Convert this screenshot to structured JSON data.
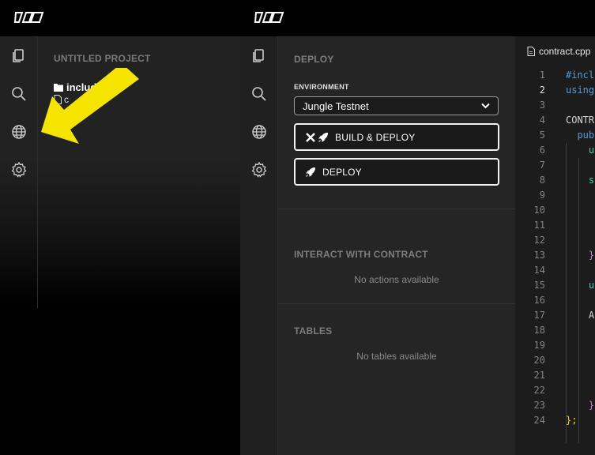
{
  "left": {
    "project_title": "UNTITLED PROJECT",
    "folder_label": "includ",
    "file_label": "c"
  },
  "deploy": {
    "title": "DEPLOY",
    "environment_label": "ENVIRONMENT",
    "environment_value": "Jungle Testnet",
    "build_deploy_label": "BUILD & DEPLOY",
    "deploy_label": "DEPLOY"
  },
  "interact": {
    "title": "INTERACT WITH CONTRACT",
    "empty": "No actions available"
  },
  "tables": {
    "title": "TABLES",
    "empty": "No tables available"
  },
  "editor": {
    "tab": "contract.cpp",
    "line_numbers": [
      "1",
      "2",
      "3",
      "4",
      "5",
      "6",
      "7",
      "8",
      "9",
      "10",
      "11",
      "12",
      "13",
      "14",
      "15",
      "16",
      "17",
      "18",
      "19",
      "20",
      "21",
      "22",
      "23",
      "24"
    ],
    "active_line": "2",
    "lines": [
      "#incl",
      "using",
      "",
      "CONTR",
      "  pub",
      "    u",
      "",
      "    s",
      "",
      "",
      "",
      "",
      "    }",
      "",
      "    u",
      "",
      "    A",
      "",
      "",
      "",
      "",
      "",
      "    }",
      "};"
    ]
  },
  "colors": {
    "accent_arrow": "#f5e300",
    "keyword": "#569cd6",
    "bracket": "#c586c0",
    "brace_close": "#ffd700"
  },
  "icons": [
    "logo-icon",
    "files-icon",
    "search-icon",
    "globe-icon",
    "gear-icon",
    "folder-icon",
    "file-icon",
    "tools-icon",
    "rocket-icon",
    "chevron-down-icon",
    "arrow-pointer"
  ]
}
